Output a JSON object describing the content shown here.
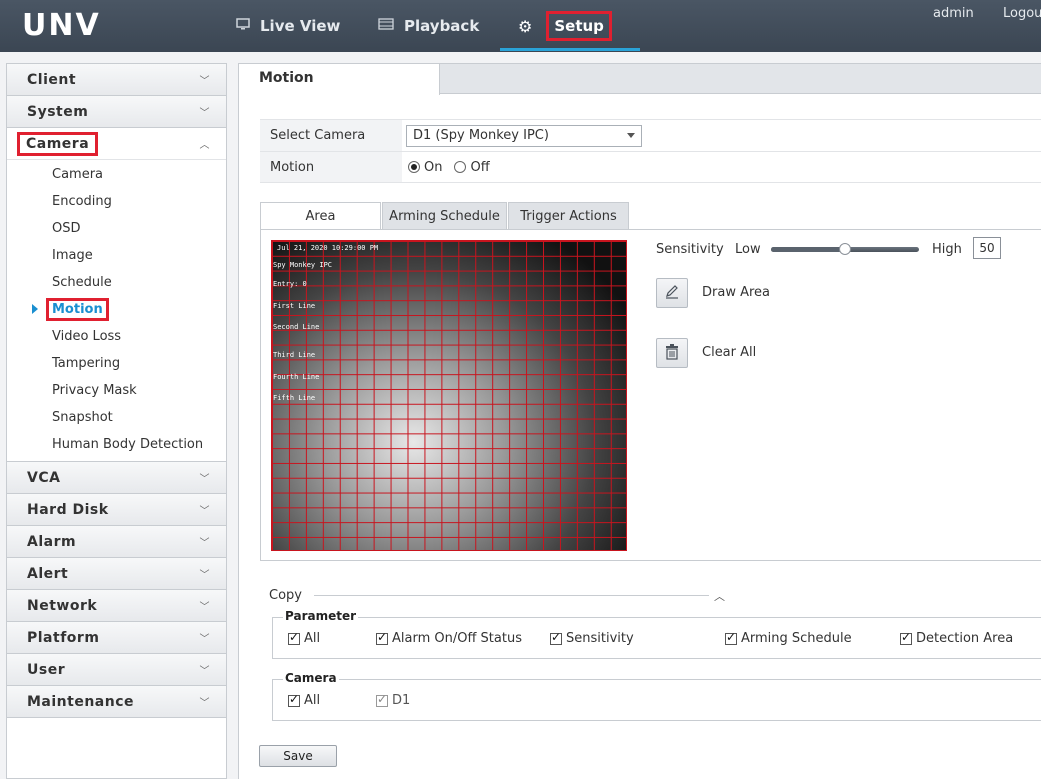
{
  "header": {
    "logo": "UNV",
    "nav": [
      {
        "label": "Live View",
        "icon": "monitor-icon"
      },
      {
        "label": "Playback",
        "icon": "film-icon"
      },
      {
        "label": "Setup",
        "icon": "gear-icon"
      }
    ],
    "user": "admin",
    "logout": "Logout"
  },
  "sidebar": {
    "groups": [
      {
        "label": "Client"
      },
      {
        "label": "System"
      },
      {
        "label": "Camera"
      },
      {
        "label": "VCA"
      },
      {
        "label": "Hard Disk"
      },
      {
        "label": "Alarm"
      },
      {
        "label": "Alert"
      },
      {
        "label": "Network"
      },
      {
        "label": "Platform"
      },
      {
        "label": "User"
      },
      {
        "label": "Maintenance"
      }
    ],
    "camera_items": [
      "Camera",
      "Encoding",
      "OSD",
      "Image",
      "Schedule",
      "Motion",
      "Video Loss",
      "Tampering",
      "Privacy Mask",
      "Snapshot",
      "Human Body Detection"
    ]
  },
  "main": {
    "tab": "Motion",
    "select_camera_label": "Select Camera",
    "select_camera_value": "D1 (Spy Monkey IPC)",
    "motion_label": "Motion",
    "motion_on": "On",
    "motion_off": "Off",
    "inner_tabs": [
      "Area",
      "Arming Schedule",
      "Trigger Actions"
    ],
    "osd": {
      "timestamp": "Jul 21, 2020 10:29:00 PM",
      "lines": [
        "Spy Monkey IPC",
        "Entry:    0",
        "First Line",
        "Second Line",
        "Third Line",
        "Fourth Line",
        "Fifth Line"
      ]
    },
    "sensitivity_label": "Sensitivity",
    "low_label": "Low",
    "high_label": "High",
    "sensitivity_value": "50",
    "sensitivity_fraction": 0.5,
    "draw_area": "Draw Area",
    "clear_all": "Clear All",
    "copy_label": "Copy",
    "parameter_legend": "Parameter",
    "parameter_items": [
      "All",
      "Alarm On/Off Status",
      "Sensitivity",
      "Arming Schedule",
      "Detection Area"
    ],
    "camera_legend": "Camera",
    "camera_items": [
      "All",
      "D1"
    ],
    "save": "Save"
  }
}
